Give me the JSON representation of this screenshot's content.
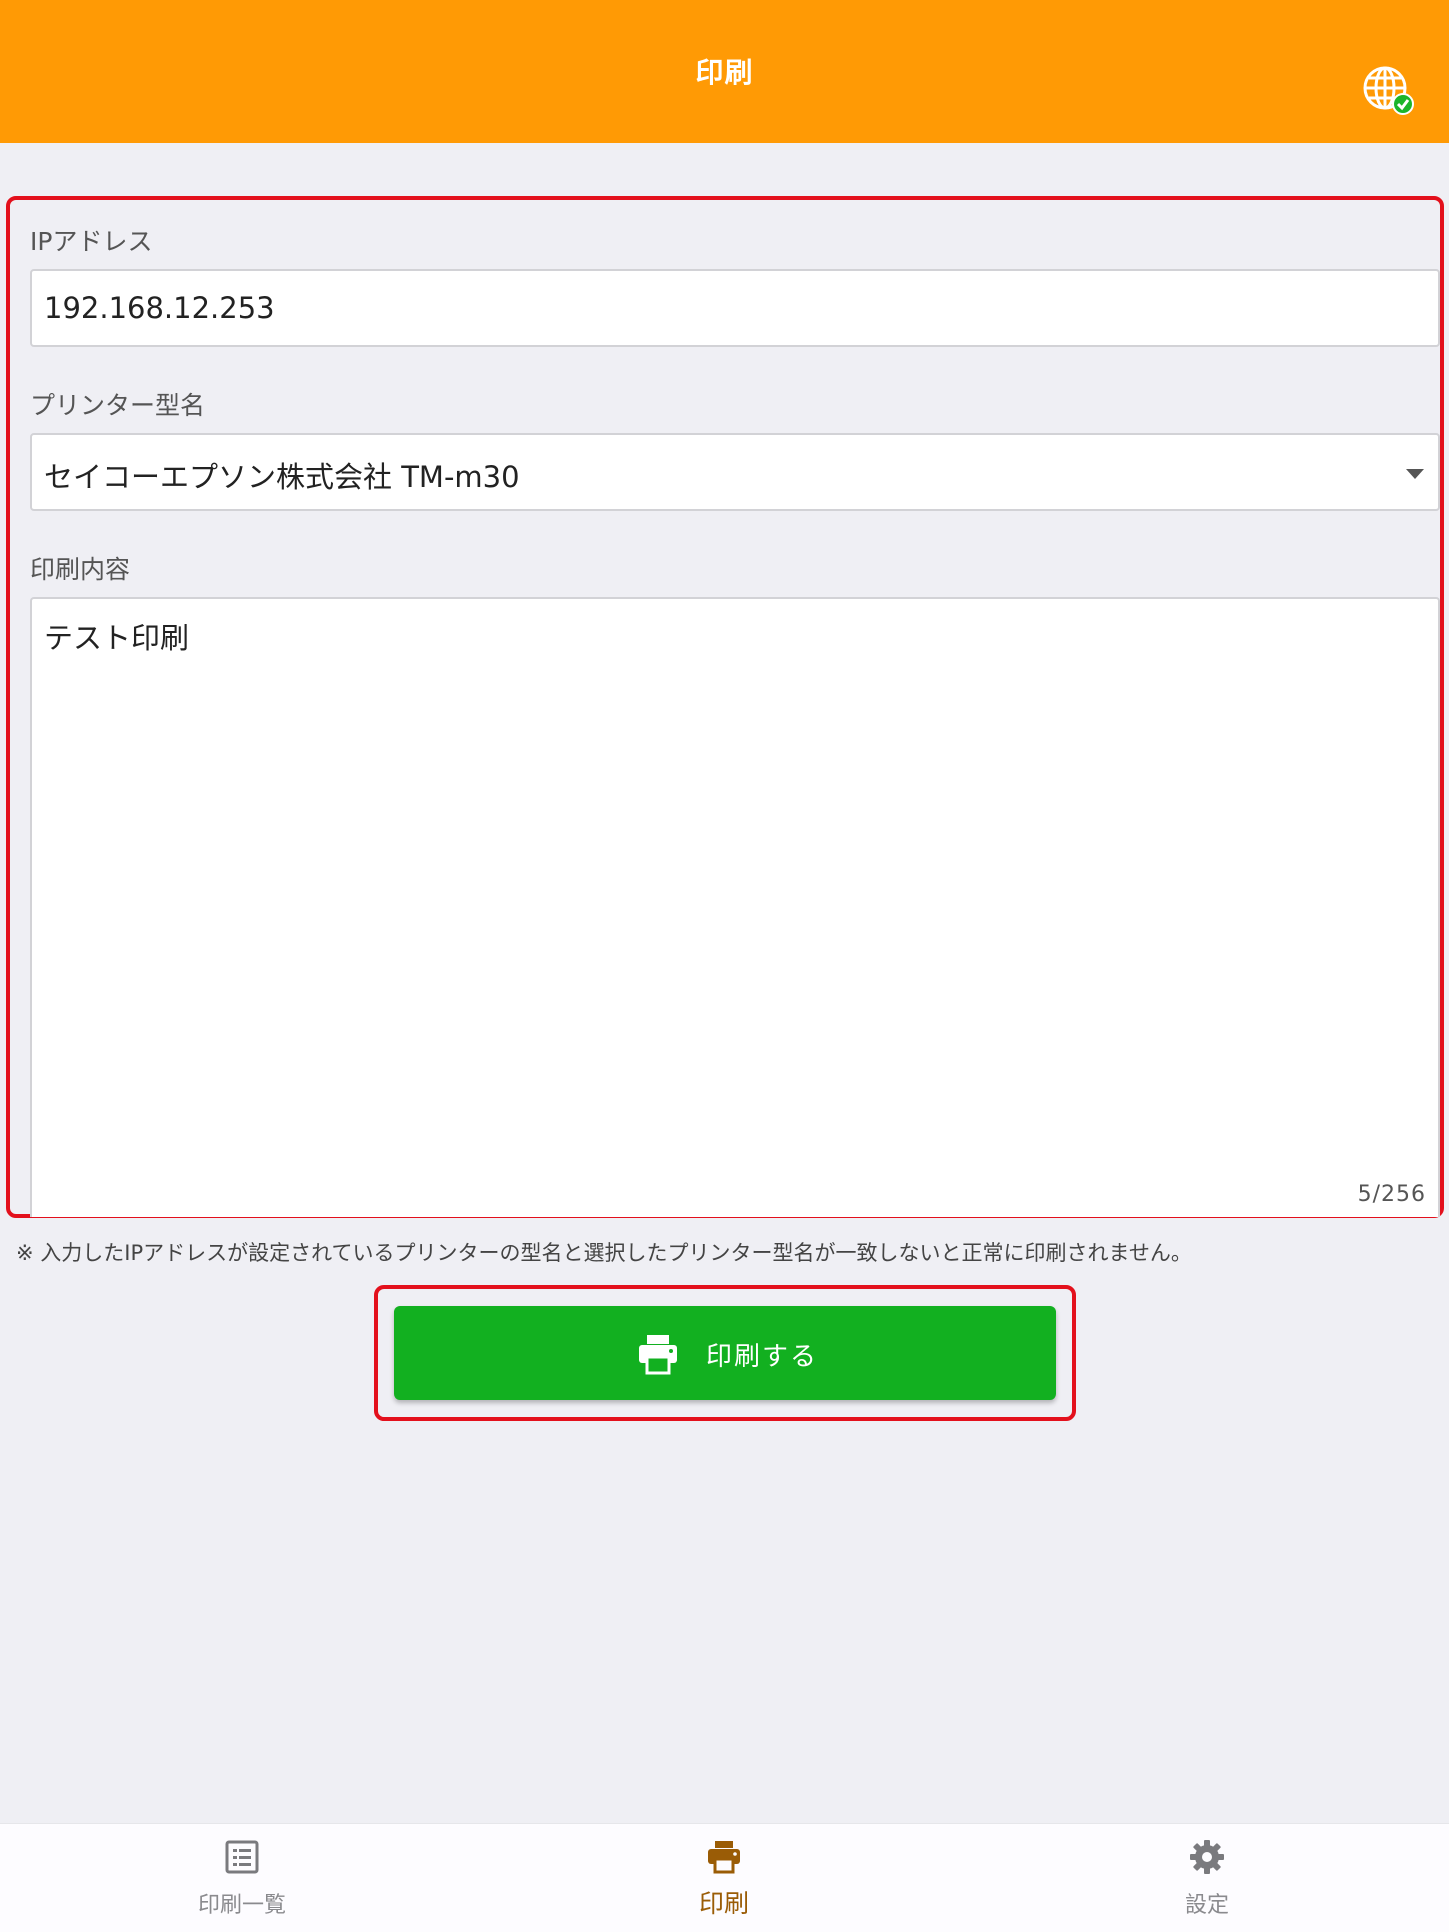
{
  "header": {
    "title": "印刷",
    "network_icon": "globe-check-icon"
  },
  "form": {
    "ip_label": "IPアドレス",
    "ip_value": "192.168.12.253",
    "model_label": "プリンター型名",
    "model_value": "セイコーエプソン株式会社 TM-m30",
    "content_label": "印刷内容",
    "content_value": "テスト印刷",
    "counter": "5/256"
  },
  "note": "※ 入力したIPアドレスが設定されているプリンターの型名と選択したプリンター型名が一致しないと正常に印刷されません。",
  "print_button": {
    "label": "印刷する",
    "icon": "printer-icon"
  },
  "tabbar": {
    "items": [
      {
        "label": "印刷一覧",
        "icon": "list-icon",
        "active": false
      },
      {
        "label": "印刷",
        "icon": "printer-icon",
        "active": true
      },
      {
        "label": "設定",
        "icon": "gear-icon",
        "active": false
      }
    ]
  },
  "colors": {
    "header": "#ff9a05",
    "button": "#12b020",
    "annotation": "#e3101c",
    "active_tab": "#9a5c06",
    "online_badge": "#1bb52a"
  }
}
